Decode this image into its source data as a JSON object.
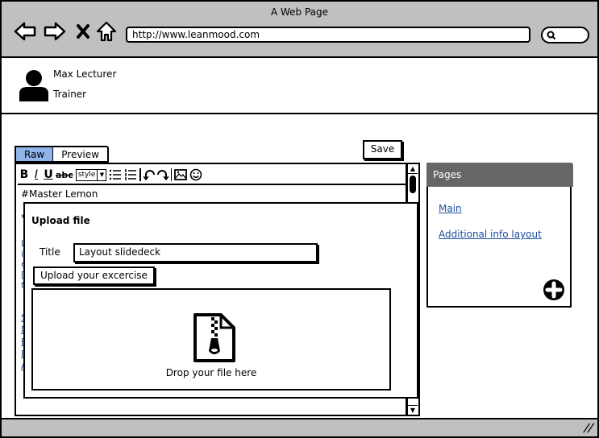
{
  "window": {
    "title": "A Web Page",
    "url": "http://www.leanmood.com",
    "nav_icons": [
      "back-arrow-icon",
      "forward-arrow-icon",
      "close-x-icon",
      "home-icon"
    ],
    "search_icon": "search-icon"
  },
  "user": {
    "name": "Max Lecturer",
    "role": "Trainer",
    "avatar_icon": "user-avatar-icon"
  },
  "editor": {
    "tabs": [
      {
        "label": "Raw",
        "active": true
      },
      {
        "label": "Preview",
        "active": false
      }
    ],
    "save_label": "Save",
    "toolbar": {
      "items": [
        "bold",
        "italic",
        "underline",
        "strikethrough",
        "style-select",
        "bulleted-list",
        "numbered-list",
        "undo",
        "redo",
        "image",
        "emoji"
      ],
      "style_label": "style"
    },
    "content_first_line": "#Master Lemon"
  },
  "upload_dialog": {
    "title": "Upload file",
    "title_label": "Title",
    "title_value": "Layout slidedeck",
    "upload_button_label": "Upload your excercise",
    "drop_text": "Drop your file here",
    "drop_icon": "zip-file-icon"
  },
  "pages_panel": {
    "header": "Pages",
    "links": [
      "Main",
      "Additional info layout"
    ],
    "add_icon": "plus-circle-icon"
  },
  "colors": {
    "chrome_gray": "#c0c0c0",
    "active_tab": "#8fb4ea",
    "panel_header": "#666666",
    "link_blue": "#1f4fa0"
  }
}
